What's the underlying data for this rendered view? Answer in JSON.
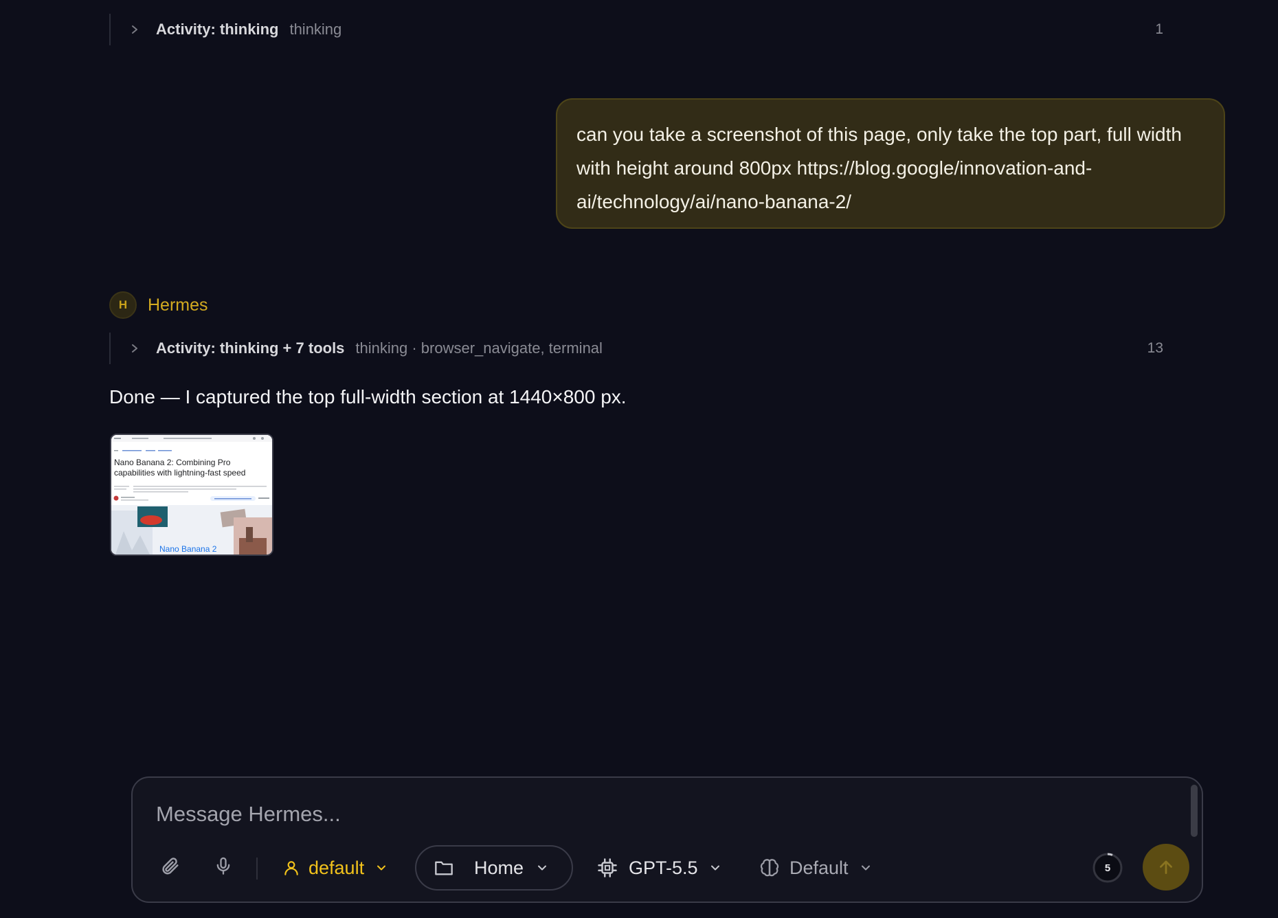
{
  "activity_1": {
    "title": "Activity: thinking",
    "subtitle": "thinking",
    "count": "1"
  },
  "user_message": {
    "text": "can you take a screenshot of this page, only take the top part, full width with height around 800px https://blog.google/innovation-and-ai/technology/ai/nano-banana-2/"
  },
  "assistant": {
    "avatar_letter": "H",
    "name": "Hermes",
    "activity": {
      "title": "Activity: thinking + 7 tools",
      "subtitle": "thinking · browser_navigate, terminal",
      "count": "13"
    },
    "reply": "Done — I captured the top full-width section at 1440×800 px.",
    "attachment": {
      "headline_line1": "Nano Banana 2: Combining Pro",
      "headline_line2": "capabilities with lightning-fast speed",
      "banner_text": "Nano Banana 2"
    }
  },
  "composer": {
    "placeholder": "Message Hermes...",
    "profile_label": "default",
    "folder_label": "Home",
    "model_label": "GPT-5.5",
    "reasoning_label": "Default",
    "context_count": "5",
    "icons": [
      "paperclip-icon",
      "microphone-icon",
      "user-icon",
      "folder-icon",
      "chip-icon",
      "brain-icon",
      "arrow-up-icon"
    ]
  },
  "colors": {
    "background": "#0d0e1a",
    "accent": "#d3ab20",
    "user_bubble": "#322c17",
    "send_button": "#5c4c12"
  }
}
